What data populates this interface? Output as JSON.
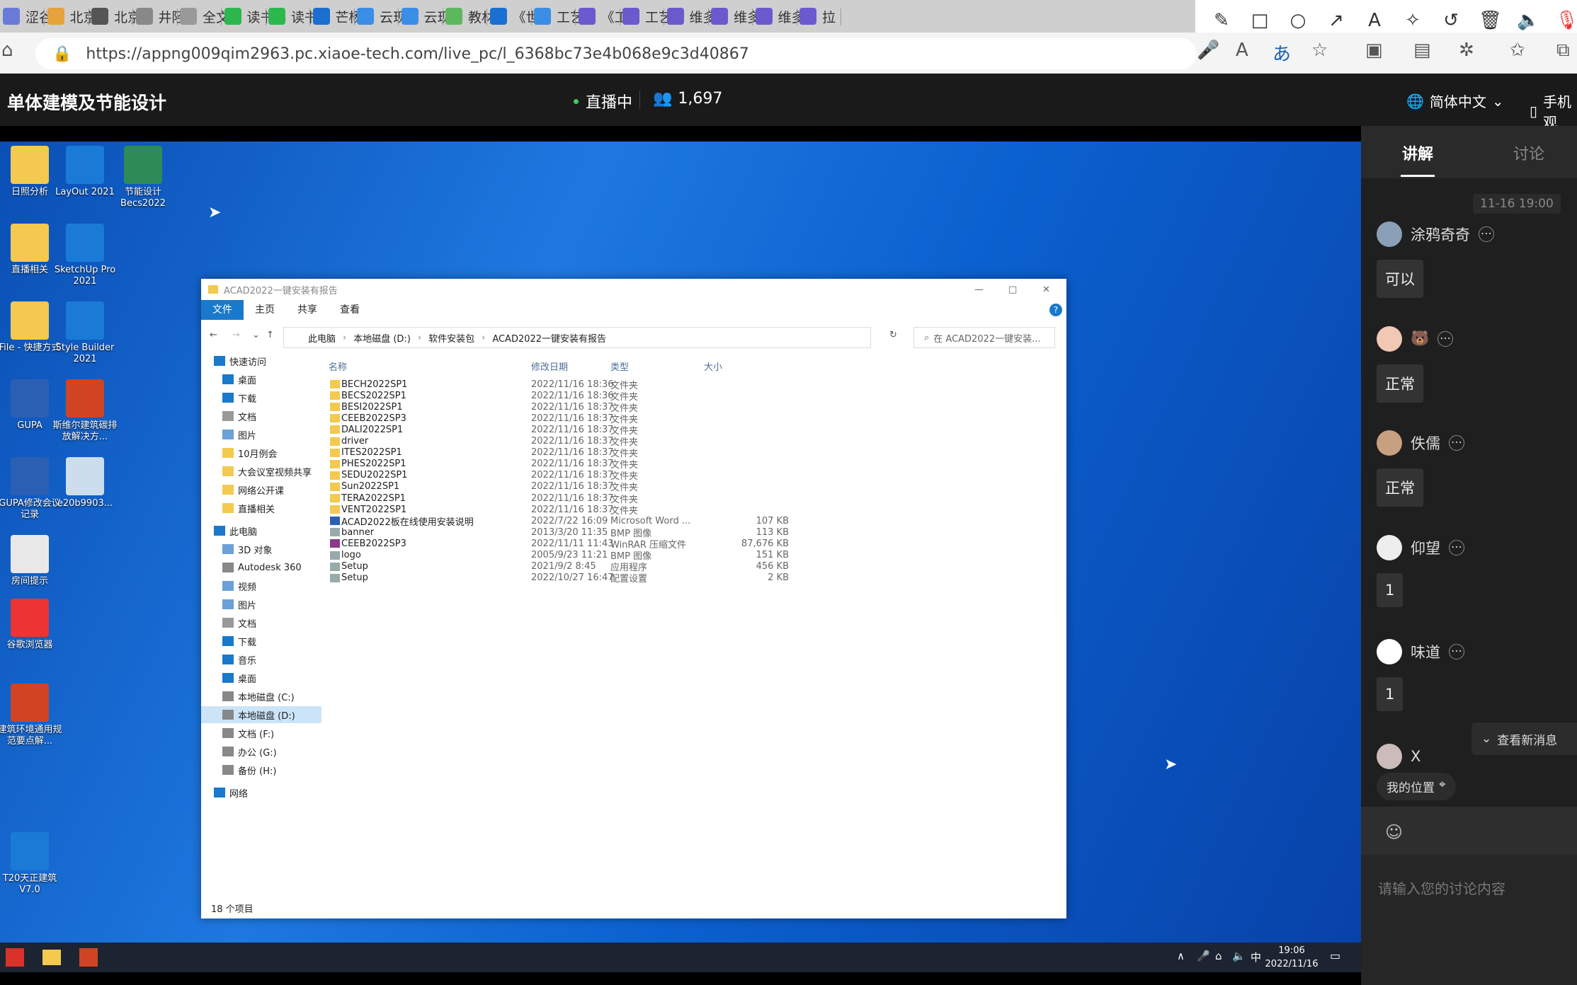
{
  "browser": {
    "tabs": [
      "涩谷",
      "北京",
      "北京",
      "井陉",
      "全文",
      "读书",
      "读书",
      "芒杨",
      "云现",
      "云现",
      "教材",
      "《世",
      "工艺",
      "《工",
      "工艺",
      "维多",
      "维多",
      "维多",
      "拉"
    ],
    "url": "https://appng009qim2963.pc.xiaoe-tech.com/live_pc/l_6368bc73e4b068e9c3d40867"
  },
  "header": {
    "title": "单体建模及节能设计",
    "live_status": "直播中",
    "viewers": "1,697",
    "language": "简体中文",
    "mobile": "手机观"
  },
  "desktop": {
    "icons": [
      "日照分析",
      "LayOut 2021",
      "节能设计Becs2022",
      "直播相关",
      "SketchUp Pro 2021",
      "File - 快捷方式",
      "Style Builder 2021",
      "GUPA",
      "斯维尔建筑碳排放解决方...",
      "GUPA修改会议记录",
      "e20b9903...",
      "房间提示",
      "谷歌浏览器",
      "建筑环境通用规范要点解...",
      "T20天正建筑V7.0"
    ]
  },
  "explorer": {
    "title": "ACAD2022一键安装有报告",
    "ribbon": [
      "文件",
      "主页",
      "共享",
      "查看"
    ],
    "breadcrumb": [
      "此电脑",
      "本地磁盘 (D:)",
      "软件安装包",
      "ACAD2022一键安装有报告"
    ],
    "search_placeholder": "在 ACAD2022一键安装...",
    "nav": [
      "快速访问",
      "桌面",
      "下载",
      "文档",
      "图片",
      "10月例会",
      "大会议室视频共享",
      "网络公开课",
      "直播相关",
      "此电脑",
      "3D 对象",
      "Autodesk 360",
      "视频",
      "图片",
      "文档",
      "下载",
      "音乐",
      "桌面",
      "本地磁盘 (C:)",
      "本地磁盘 (D:)",
      "文档 (F:)",
      "办公 (G:)",
      "备份 (H:)",
      "网络"
    ],
    "columns": [
      "名称",
      "修改日期",
      "类型",
      "大小"
    ],
    "files": [
      {
        "name": "BECH2022SP1",
        "date": "2022/11/16 18:36",
        "type": "文件夹",
        "size": ""
      },
      {
        "name": "BECS2022SP1",
        "date": "2022/11/16 18:36",
        "type": "文件夹",
        "size": ""
      },
      {
        "name": "BESI2022SP1",
        "date": "2022/11/16 18:37",
        "type": "文件夹",
        "size": ""
      },
      {
        "name": "CEEB2022SP3",
        "date": "2022/11/16 18:37",
        "type": "文件夹",
        "size": ""
      },
      {
        "name": "DALI2022SP1",
        "date": "2022/11/16 18:37",
        "type": "文件夹",
        "size": ""
      },
      {
        "name": "driver",
        "date": "2022/11/16 18:37",
        "type": "文件夹",
        "size": ""
      },
      {
        "name": "ITES2022SP1",
        "date": "2022/11/16 18:37",
        "type": "文件夹",
        "size": ""
      },
      {
        "name": "PHES2022SP1",
        "date": "2022/11/16 18:37",
        "type": "文件夹",
        "size": ""
      },
      {
        "name": "SEDU2022SP1",
        "date": "2022/11/16 18:37",
        "type": "文件夹",
        "size": ""
      },
      {
        "name": "Sun2022SP1",
        "date": "2022/11/16 18:37",
        "type": "文件夹",
        "size": ""
      },
      {
        "name": "TERA2022SP1",
        "date": "2022/11/16 18:37",
        "type": "文件夹",
        "size": ""
      },
      {
        "name": "VENT2022SP1",
        "date": "2022/11/16 18:37",
        "type": "文件夹",
        "size": ""
      },
      {
        "name": "ACAD2022板在线使用安装说明",
        "date": "2022/7/22 16:09",
        "type": "Microsoft Word ...",
        "size": "107 KB"
      },
      {
        "name": "banner",
        "date": "2013/3/20 11:35",
        "type": "BMP 图像",
        "size": "113 KB"
      },
      {
        "name": "CEEB2022SP3",
        "date": "2022/11/11 11:43",
        "type": "WinRAR 压缩文件",
        "size": "87,676 KB"
      },
      {
        "name": "logo",
        "date": "2005/9/23 11:21",
        "type": "BMP 图像",
        "size": "151 KB"
      },
      {
        "name": "Setup",
        "date": "2021/9/2 8:45",
        "type": "应用程序",
        "size": "456 KB"
      },
      {
        "name": "Setup",
        "date": "2022/10/27 16:47",
        "type": "配置设置",
        "size": "2 KB"
      }
    ],
    "status": "18 个项目"
  },
  "taskbar": {
    "time": "19:06",
    "date": "2022/11/16",
    "ime": "中"
  },
  "sidebar": {
    "tabs": [
      "讲解",
      "讨论"
    ],
    "timestamp": "11-16 19:00",
    "messages": [
      {
        "user": "涂鸦奇奇",
        "text": "可以"
      },
      {
        "user": "🐻",
        "text": "正常"
      },
      {
        "user": "佚儒",
        "text": "正常"
      },
      {
        "user": "仰望",
        "text": "1"
      },
      {
        "user": "味道",
        "text": "1"
      },
      {
        "user": "X",
        "text": ""
      }
    ],
    "new_msg": "查看新消息",
    "my_position": "我的位置",
    "input_placeholder": "请输入您的讨论内容"
  }
}
